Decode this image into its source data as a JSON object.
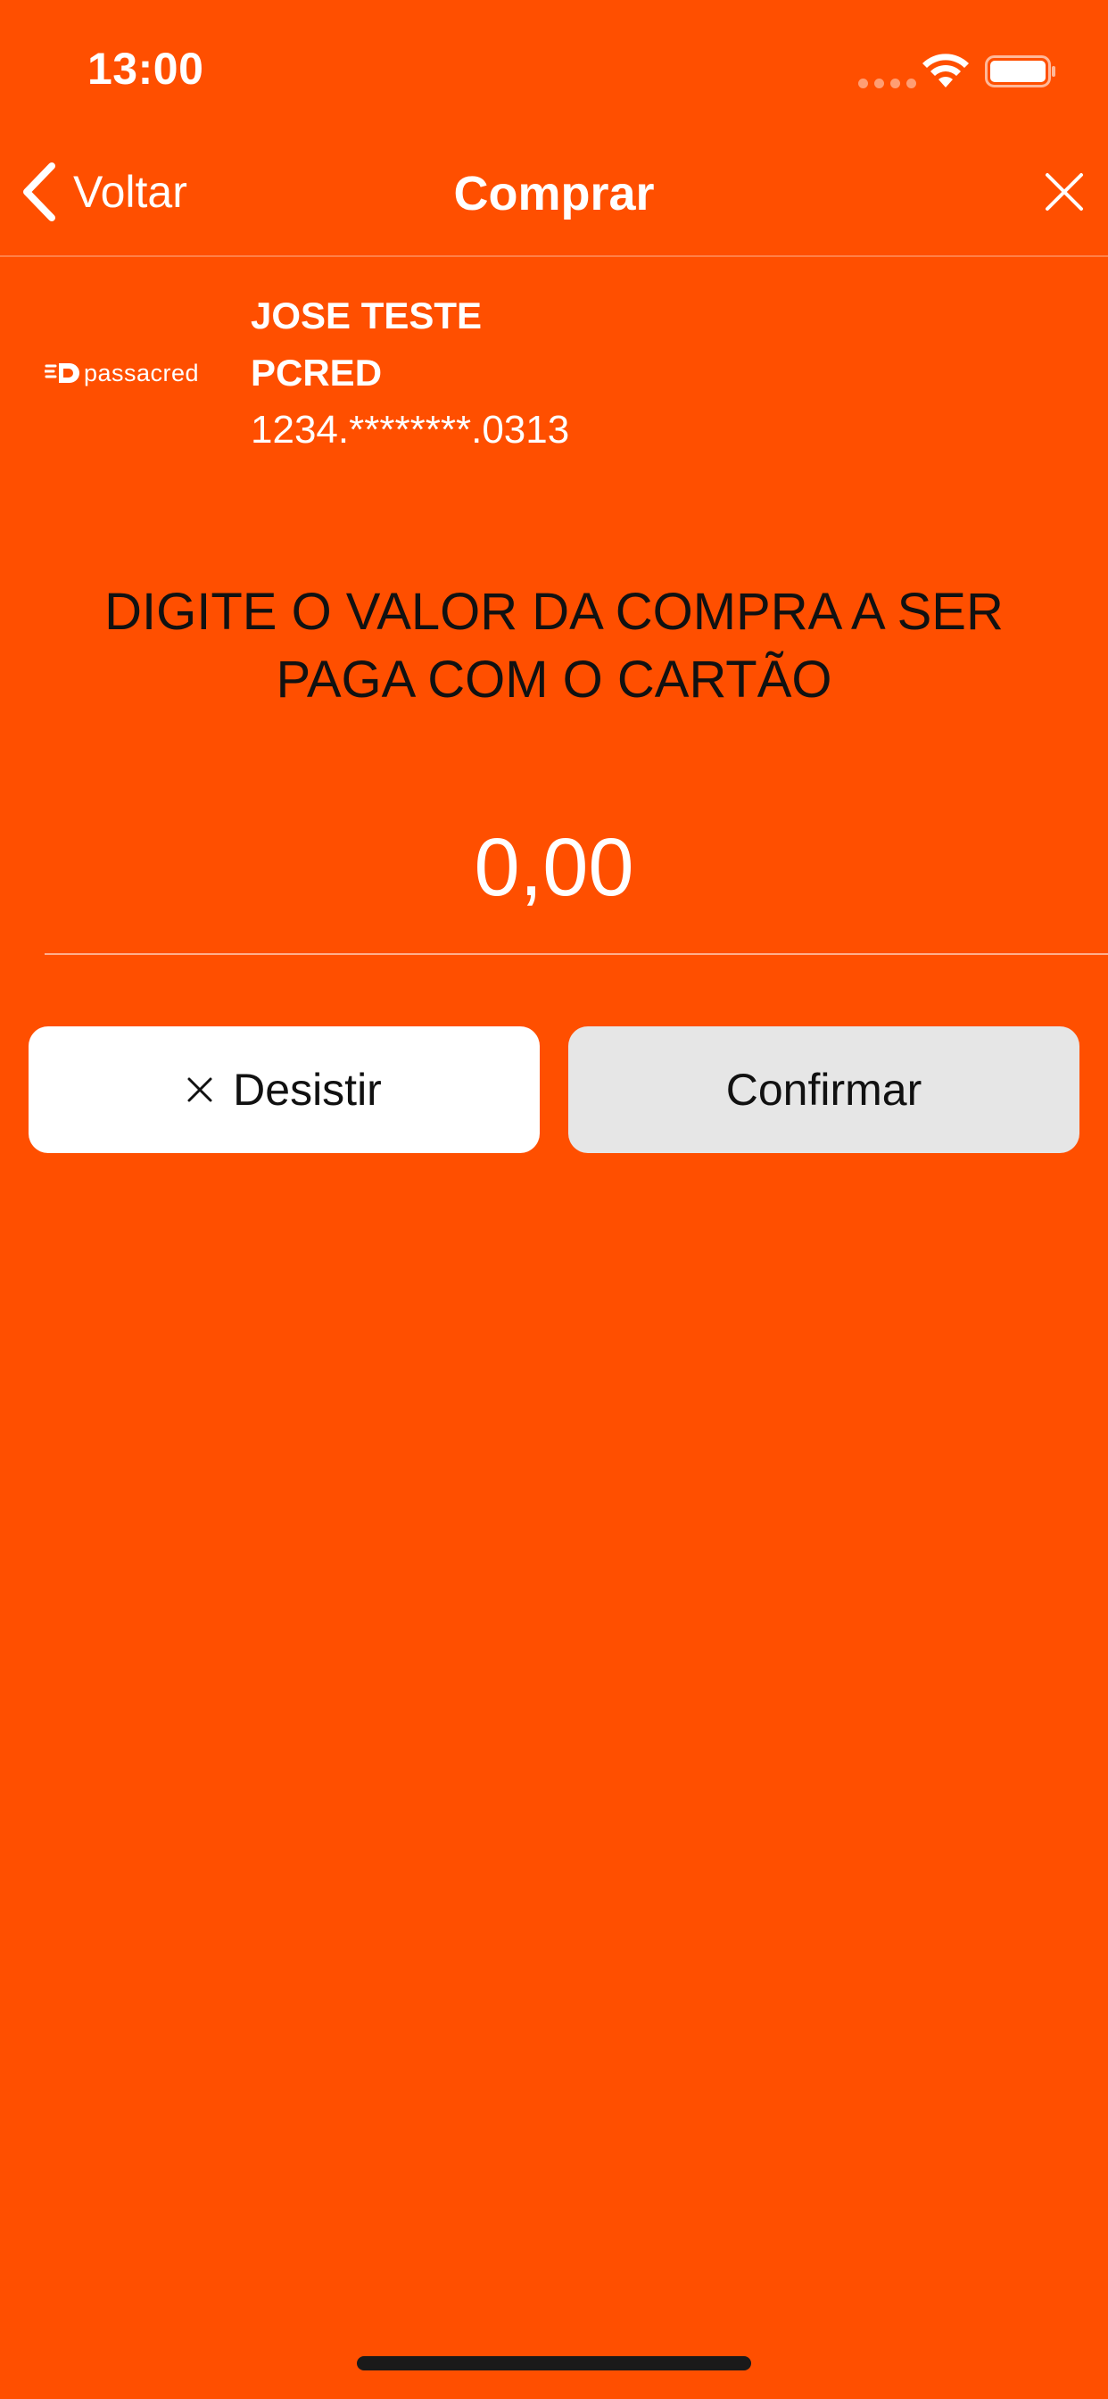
{
  "status_bar": {
    "time": "13:00"
  },
  "nav": {
    "back_label": "Voltar",
    "title": "Comprar"
  },
  "card": {
    "brand": "passacred",
    "holder_name": "JOSE TESTE",
    "product": "PCRED",
    "number": "1234.********.0313"
  },
  "instruction": "DIGITE O VALOR DA COMPRA A SER PAGA COM O CARTÃO",
  "amount": {
    "value": "0,00"
  },
  "buttons": {
    "cancel_label": "Desistir",
    "confirm_label": "Confirmar"
  },
  "colors": {
    "background": "#FF4F00",
    "cancel_button": "#FFFFFF",
    "confirm_button": "#E6E6E6"
  },
  "icons": {
    "back": "chevron-left-icon",
    "close": "close-icon",
    "cancel": "close-icon",
    "wifi": "wifi-icon",
    "battery": "battery-icon"
  }
}
